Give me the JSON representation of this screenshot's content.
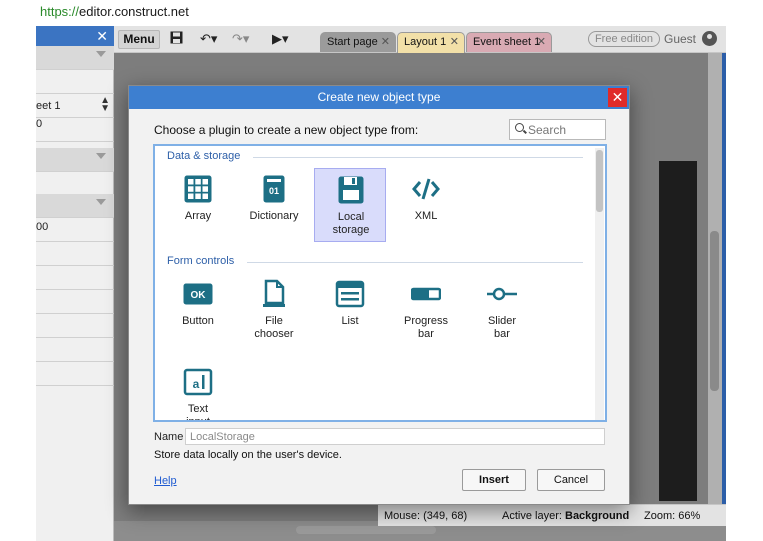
{
  "browser": {
    "url_scheme": "https://",
    "url_host": "editor.construct.net"
  },
  "left_panel": {
    "rows": [
      {
        "text": "",
        "chevron": true
      },
      {
        "text": "eet 1",
        "spinner": true
      },
      {
        "text": "0"
      },
      {
        "text": "",
        "chevron": true
      },
      {
        "text": ""
      },
      {
        "text": "",
        "chevron": true
      },
      {
        "text": "00"
      }
    ]
  },
  "toolbar": {
    "menu_label": "Menu",
    "tabs": [
      {
        "label": "Start page",
        "color": "#9b9b9b"
      },
      {
        "label": "Layout 1",
        "color": "#f2e0a8"
      },
      {
        "label": "Event sheet 1",
        "color": "#d9aab3"
      }
    ],
    "edition_badge": "Free edition",
    "user_label": "Guest"
  },
  "statusbar": {
    "mouse": "Mouse: (349, 68)",
    "active_layer_prefix": "Active layer:",
    "active_layer": "Background",
    "zoom": "Zoom: 66%"
  },
  "dialog": {
    "title": "Create new object type",
    "prompt": "Choose a plugin to create a new object type from:",
    "search_placeholder": "Search",
    "sections": [
      {
        "title": "Data & storage",
        "plugins": [
          {
            "label": "Array",
            "icon": "grid-icon"
          },
          {
            "label": "Dictionary",
            "icon": "dictionary-icon"
          },
          {
            "label": "Local storage",
            "icon": "floppy-disk-icon",
            "selected": true
          },
          {
            "label": "XML",
            "icon": "code-brackets-icon"
          }
        ]
      },
      {
        "title": "Form controls",
        "plugins": [
          {
            "label": "Button",
            "icon": "ok-button-icon"
          },
          {
            "label": "File chooser",
            "icon": "file-icon"
          },
          {
            "label": "List",
            "icon": "list-icon"
          },
          {
            "label": "Progress bar",
            "icon": "progress-bar-icon"
          },
          {
            "label": "Slider bar",
            "icon": "slider-icon"
          },
          {
            "label": "Text input",
            "icon": "text-input-icon"
          }
        ]
      }
    ],
    "name_label": "Name",
    "name_value": "LocalStorage",
    "description": "Store data locally on the user's device.",
    "help_label": "Help",
    "insert_label": "Insert",
    "cancel_label": "Cancel",
    "accent_color": "#3d7fd0",
    "icon_color": "#1d6f85"
  }
}
